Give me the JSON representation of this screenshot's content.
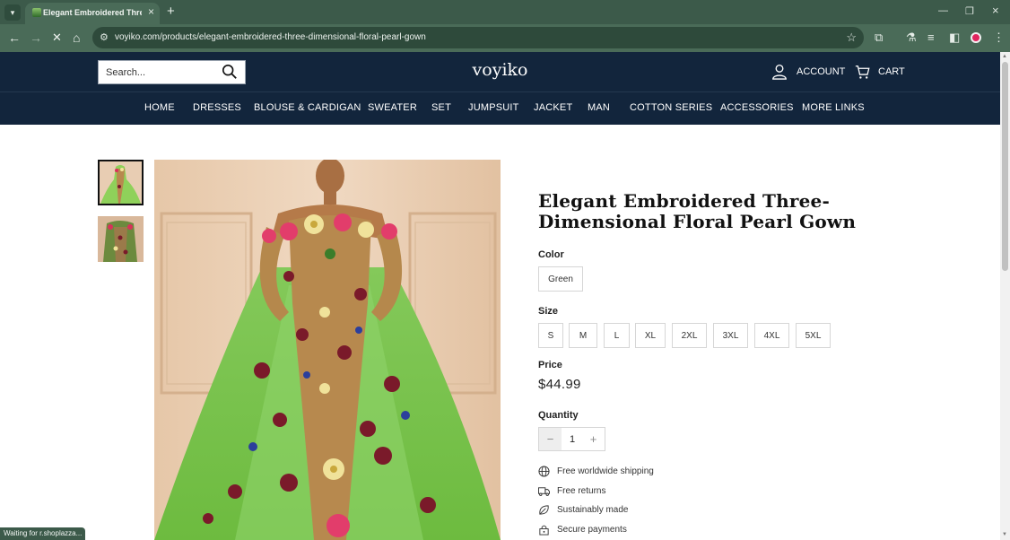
{
  "browser": {
    "tab_title": "Elegant Embroidered Three-Di",
    "url": "voyiko.com/products/elegant-embroidered-three-dimensional-floral-pearl-gown",
    "status_text": "Waiting for r.shoplazza..."
  },
  "header": {
    "search_placeholder": "Search...",
    "logo": "voyiko",
    "account_label": "ACCOUNT",
    "cart_label": "CART",
    "background_color": "#12253c"
  },
  "nav": {
    "items": [
      "HOME",
      "DRESSES",
      "BLOUSE & CARDIGAN",
      "SWEATER",
      "SET",
      "JUMPSUIT",
      "JACKET",
      "MAN",
      "COTTON SERIES",
      "ACCESSORIES",
      "MORE LINKS"
    ]
  },
  "product": {
    "title": "Elegant Embroidered Three-Dimensional Floral Pearl Gown",
    "color_label": "Color",
    "color_options": [
      "Green"
    ],
    "size_label": "Size",
    "size_options": [
      "S",
      "M",
      "L",
      "XL",
      "2XL",
      "3XL",
      "4XL",
      "5XL"
    ],
    "price_label": "Price",
    "price": "$44.99",
    "quantity_label": "Quantity",
    "quantity": "1",
    "features": [
      {
        "icon": "globe-icon",
        "text": "Free worldwide shipping"
      },
      {
        "icon": "truck-icon",
        "text": "Free returns"
      },
      {
        "icon": "leaf-icon",
        "text": "Sustainably made"
      },
      {
        "icon": "lock-icon",
        "text": "Secure payments"
      }
    ]
  }
}
